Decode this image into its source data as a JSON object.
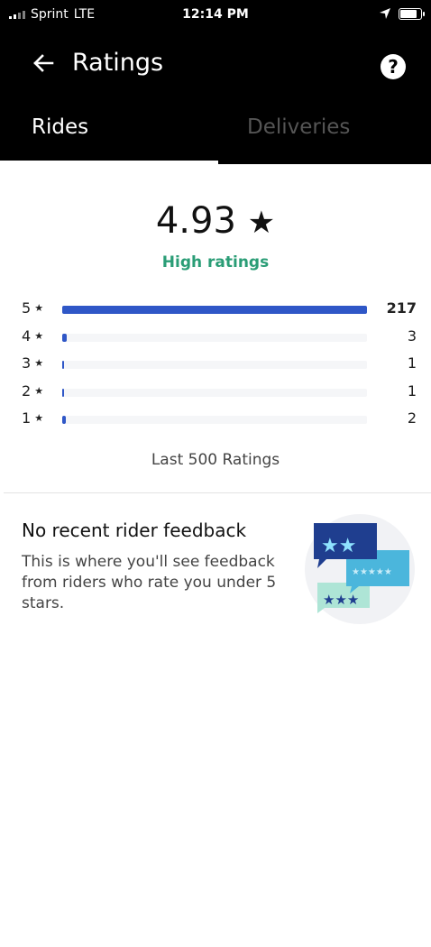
{
  "status_bar": {
    "carrier": "Sprint",
    "network": "LTE",
    "time": "12:14 PM"
  },
  "header": {
    "title": "Ratings",
    "help_label": "?"
  },
  "tabs": [
    {
      "label": "Rides",
      "selected": true
    },
    {
      "label": "Deliveries",
      "selected": false
    }
  ],
  "summary": {
    "score": "4.93",
    "star": "★",
    "label": "High ratings"
  },
  "distribution": {
    "rows": [
      {
        "stars": "5",
        "count": "217"
      },
      {
        "stars": "4",
        "count": "3"
      },
      {
        "stars": "3",
        "count": "1"
      },
      {
        "stars": "2",
        "count": "1"
      },
      {
        "stars": "1",
        "count": "2"
      }
    ],
    "footer": "Last 500 Ratings"
  },
  "feedback": {
    "title": "No recent rider feedback",
    "body": "This is where you'll see feedback from riders who rate you under 5 stars."
  },
  "colors": {
    "accent_blue": "#2f57c7",
    "high_ratings_green": "#2a9d76",
    "header_bg": "#000000"
  }
}
